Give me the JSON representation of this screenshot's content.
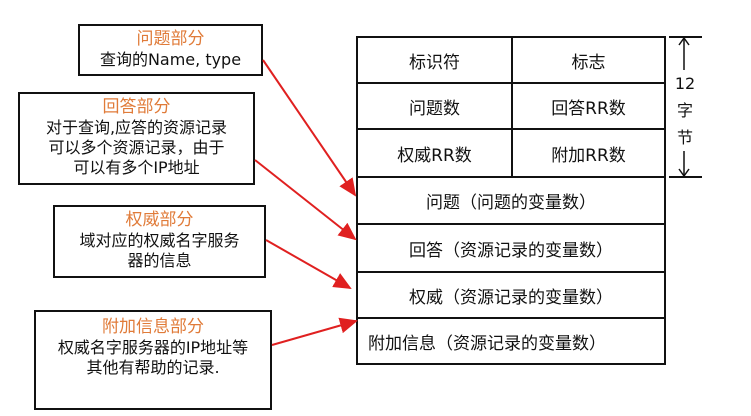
{
  "callouts": {
    "question": {
      "title": "问题部分",
      "body": "查询的Name, type"
    },
    "answer": {
      "title": "回答部分",
      "body_lines": [
        "对于查询,应答的资源记录",
        "可以多个资源记录，由于",
        "可以有多个IP地址"
      ]
    },
    "authority": {
      "title": "权威部分",
      "body_lines": [
        "域对应的权威名字服务",
        "器的信息"
      ]
    },
    "additional": {
      "title": "附加信息部分",
      "body_lines": [
        "权威名字服务器的IP地址等",
        "其他有帮助的记录."
      ]
    }
  },
  "header_rows": [
    [
      "标识符",
      "标志"
    ],
    [
      "问题数",
      "回答RR数"
    ],
    [
      "权威RR数",
      "附加RR数"
    ]
  ],
  "sections": [
    "问题（问题的变量数）",
    "回答（资源记录的变量数）",
    "权威（资源记录的变量数）",
    "附加信息（资源记录的变量数）"
  ],
  "side_label": {
    "chars": [
      "12",
      "字",
      "节"
    ]
  },
  "colors": {
    "callout_title": "#e07b39",
    "arrow": "#e02020",
    "border": "#111111"
  }
}
